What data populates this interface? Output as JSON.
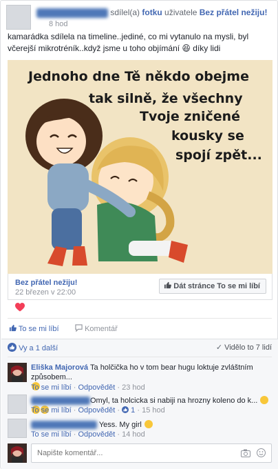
{
  "header": {
    "action_text": "sdílel(a)",
    "object_link": "fotku",
    "mid_text": "uživatele",
    "page_link": "Bez přátel nežiju!",
    "time": "8 hod"
  },
  "post_text": "kamarádka sdílela na timeline..jediné, co mi vytanulo na mysli, byl včerejší mikrotréník..když jsme u toho objímání 😆 díky lidi",
  "image": {
    "lines": [
      "Jednoho dne Tě někdo obejme",
      "tak silně, že všechny",
      "Tvoje zničené",
      "kousky se",
      "spojí zpět..."
    ]
  },
  "shared_page": {
    "name": "Bez přátel nežiju!",
    "date": "22 březen v 22:00",
    "like_page_button": "Dát stránce To se mi líbí"
  },
  "actions": {
    "like": "To se mi líbí",
    "comment": "Komentář"
  },
  "reactions": {
    "summary": "Vy a 1 další",
    "seen": "Vidělo to 7 lidí"
  },
  "comments": [
    {
      "author": "Eliška Majorová",
      "text": "Ta holčička ho v tom bear hugu loktuje zvláštním způsobem...",
      "like": "To se mi líbí",
      "reply": "Odpovědět",
      "time": "23 hod",
      "reaction_count": ""
    },
    {
      "author": "",
      "text": "Omyl, ta holcicka si nabiji na hrozny koleno do k...",
      "like": "To se mi líbí",
      "reply": "Odpovědět",
      "time": "15 hod",
      "reaction_count": "1"
    },
    {
      "author": "",
      "text": "Yess. My girl",
      "like": "To se mi líbí",
      "reply": "Odpovědět",
      "time": "14 hod",
      "reaction_count": ""
    }
  ],
  "comment_input": {
    "placeholder": "Napište komentář..."
  },
  "colors": {
    "link": "#4267b2",
    "muted": "#90949c",
    "heart": "#f33e58",
    "comments_bg": "#f6f7f9"
  }
}
